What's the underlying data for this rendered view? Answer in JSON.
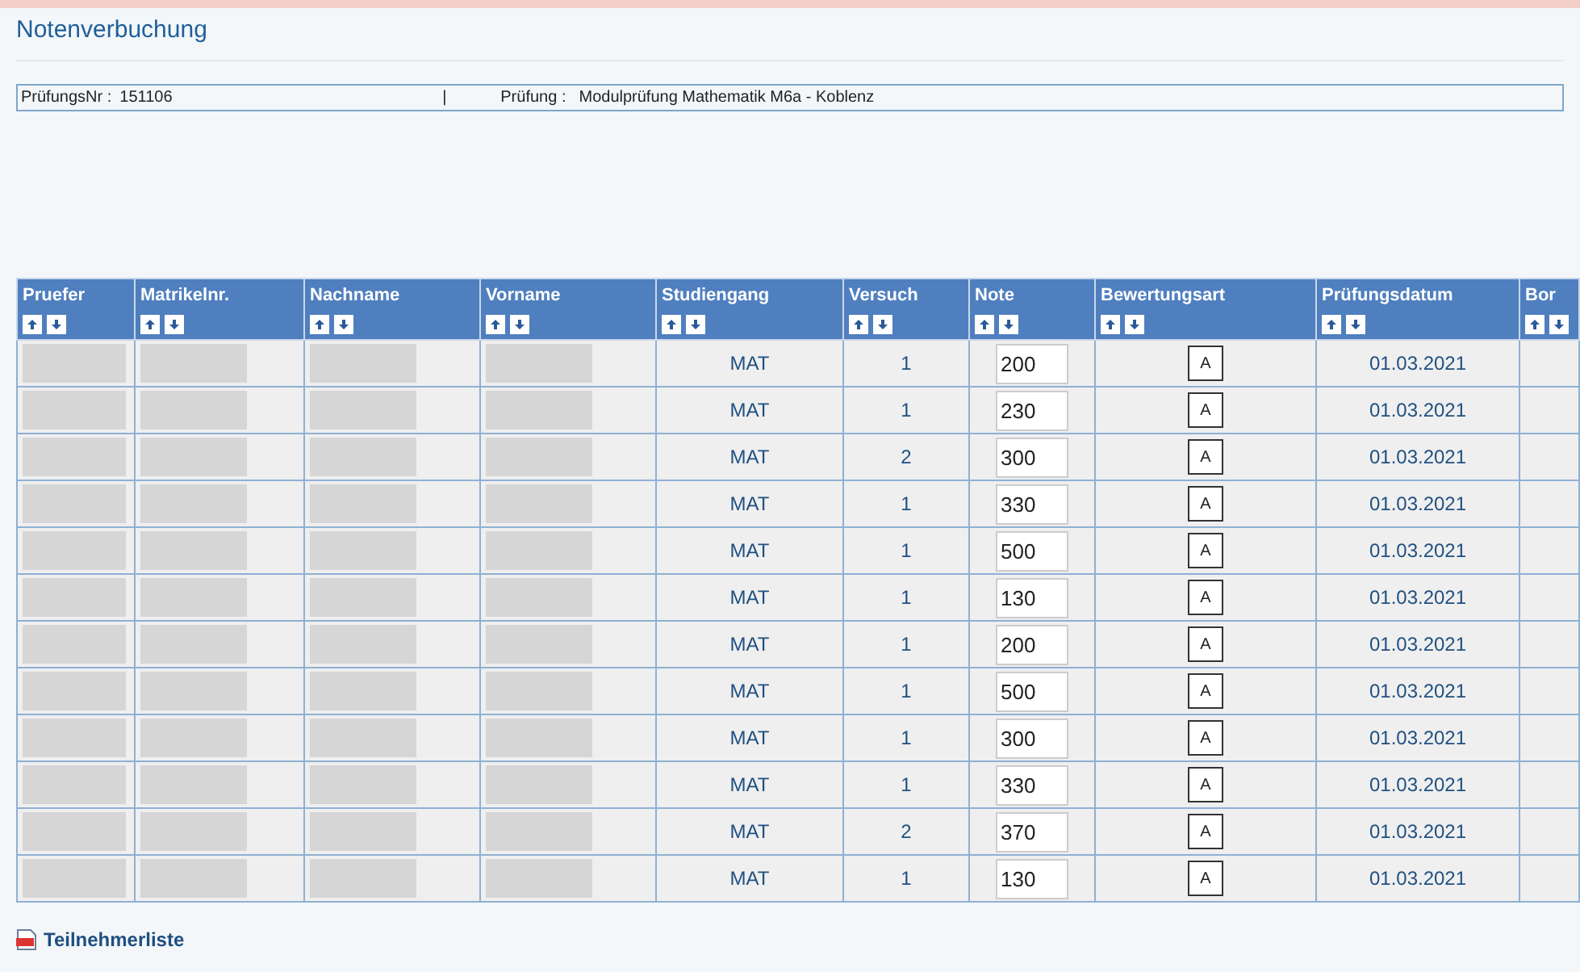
{
  "page_title": "Notenverbuchung",
  "info_bar": {
    "exam_number_label": "PrüfungsNr :",
    "exam_number": "151106",
    "separator": "|",
    "exam_label": "Prüfung :",
    "exam_name": "Modulprüfung Mathematik M6a - Koblenz"
  },
  "table": {
    "columns": [
      {
        "label": "Pruefer"
      },
      {
        "label": "Matrikelnr."
      },
      {
        "label": "Nachname"
      },
      {
        "label": "Vorname"
      },
      {
        "label": "Studiengang"
      },
      {
        "label": "Versuch"
      },
      {
        "label": "Note"
      },
      {
        "label": "Bewertungsart"
      },
      {
        "label": "Prüfungsdatum"
      },
      {
        "label": "Bor"
      }
    ],
    "rows": [
      {
        "studiengang": "MAT",
        "versuch": "1",
        "note": "200",
        "bewertungsart": "A",
        "datum": "01.03.2021"
      },
      {
        "studiengang": "MAT",
        "versuch": "1",
        "note": "230",
        "bewertungsart": "A",
        "datum": "01.03.2021"
      },
      {
        "studiengang": "MAT",
        "versuch": "2",
        "note": "300",
        "bewertungsart": "A",
        "datum": "01.03.2021"
      },
      {
        "studiengang": "MAT",
        "versuch": "1",
        "note": "330",
        "bewertungsart": "A",
        "datum": "01.03.2021"
      },
      {
        "studiengang": "MAT",
        "versuch": "1",
        "note": "500",
        "bewertungsart": "A",
        "datum": "01.03.2021"
      },
      {
        "studiengang": "MAT",
        "versuch": "1",
        "note": "130",
        "bewertungsart": "A",
        "datum": "01.03.2021"
      },
      {
        "studiengang": "MAT",
        "versuch": "1",
        "note": "200",
        "bewertungsart": "A",
        "datum": "01.03.2021"
      },
      {
        "studiengang": "MAT",
        "versuch": "1",
        "note": "500",
        "bewertungsart": "A",
        "datum": "01.03.2021"
      },
      {
        "studiengang": "MAT",
        "versuch": "1",
        "note": "300",
        "bewertungsart": "A",
        "datum": "01.03.2021"
      },
      {
        "studiengang": "MAT",
        "versuch": "1",
        "note": "330",
        "bewertungsart": "A",
        "datum": "01.03.2021"
      },
      {
        "studiengang": "MAT",
        "versuch": "2",
        "note": "370",
        "bewertungsart": "A",
        "datum": "01.03.2021"
      },
      {
        "studiengang": "MAT",
        "versuch": "1",
        "note": "130",
        "bewertungsart": "A",
        "datum": "01.03.2021"
      }
    ]
  },
  "footer_link": "Teilnehmerliste"
}
